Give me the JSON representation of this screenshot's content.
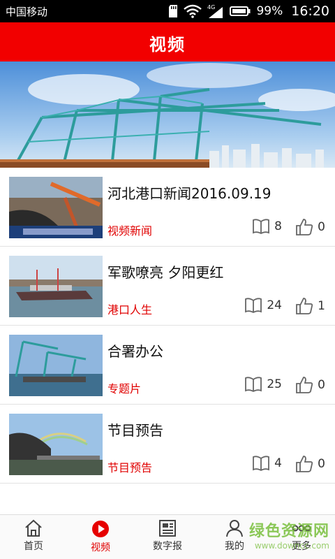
{
  "status_bar": {
    "carrier": "中国移动",
    "network": "4G",
    "battery_percent": "99%",
    "time": "16:20",
    "icons": [
      "sdcard-icon",
      "wifi-icon",
      "signal-4g-icon",
      "battery-icon"
    ]
  },
  "header": {
    "title": "视频"
  },
  "banner": {
    "subject": "port-cranes-banner"
  },
  "videos": [
    {
      "title": "河北港口新闻2016.09.19",
      "category": "视频新闻",
      "views": "8",
      "likes": "0"
    },
    {
      "title": "军歌嘹亮 夕阳更红",
      "category": "港口人生",
      "views": "24",
      "likes": "1"
    },
    {
      "title": "合署办公",
      "category": "专题片",
      "views": "25",
      "likes": "0"
    },
    {
      "title": "节目预告",
      "category": "节目预告",
      "views": "4",
      "likes": "0"
    }
  ],
  "bottom_nav": [
    {
      "label": "首页",
      "icon": "home-icon",
      "active": false
    },
    {
      "label": "视频",
      "icon": "play-icon",
      "active": true
    },
    {
      "label": "数字报",
      "icon": "newspaper-icon",
      "active": false
    },
    {
      "label": "我的",
      "icon": "user-icon",
      "active": false
    },
    {
      "label": "更多",
      "icon": "more-icon",
      "active": false
    }
  ],
  "watermark": {
    "text_cn": "绿色资源网",
    "text_en": "www.downcc.com"
  },
  "colors": {
    "brand_red": "#f20000",
    "category_red": "#e00000"
  }
}
